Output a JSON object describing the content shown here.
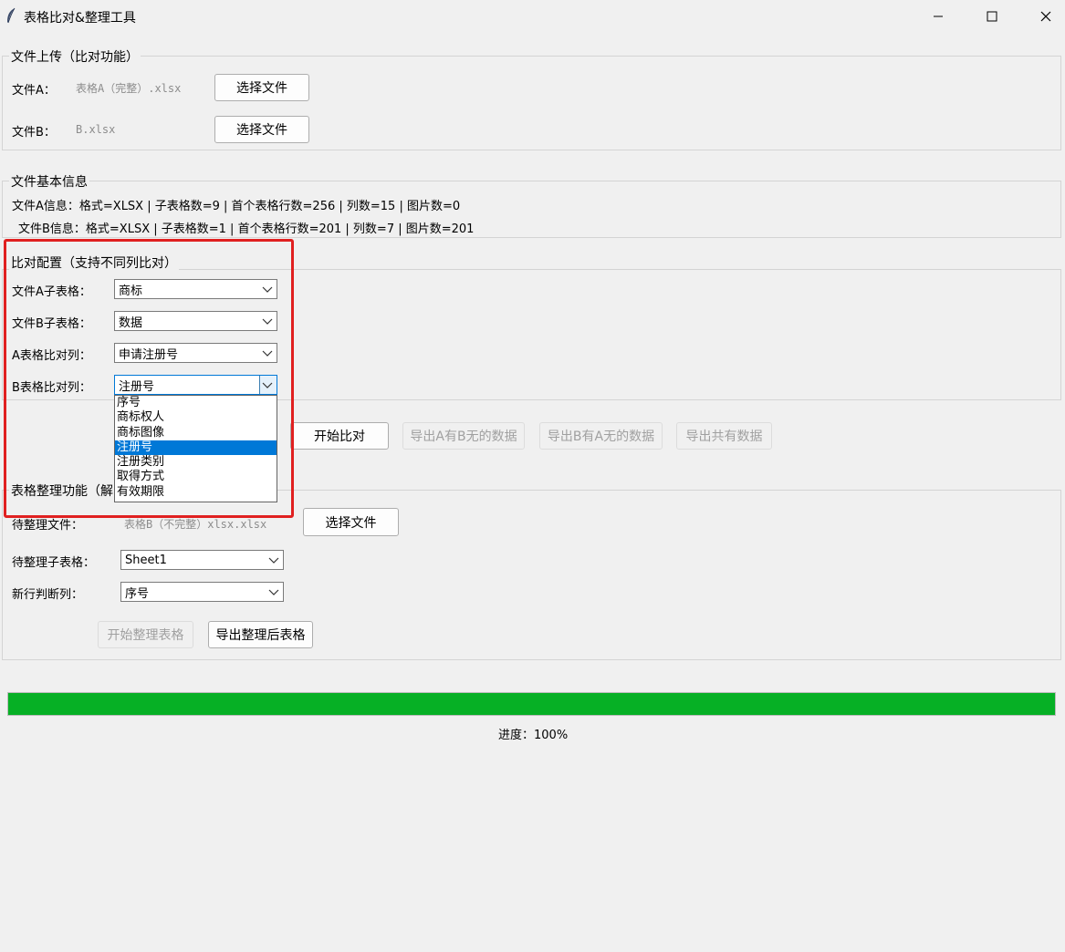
{
  "window": {
    "title": "表格比对&整理工具",
    "icon": "feather-icon"
  },
  "upload": {
    "legend": "文件上传（比对功能）",
    "fileA_label": "文件A：",
    "fileA_value": "表格A（完整）.xlsx",
    "fileB_label": "文件B：",
    "fileB_value": "B.xlsx",
    "choose_label": "选择文件"
  },
  "info": {
    "legend": "文件基本信息",
    "fileA_info": "文件A信息：格式=XLSX | 子表格数=9 | 首个表格行数=256 | 列数=15 | 图片数=0",
    "fileB_info": "文件B信息：格式=XLSX | 子表格数=1 | 首个表格行数=201 | 列数=7 | 图片数=201"
  },
  "compare": {
    "legend": "比对配置（支持不同列比对）",
    "sheetA_label": "文件A子表格：",
    "sheetA_value": "商标",
    "sheetB_label": "文件B子表格：",
    "sheetB_value": "数据",
    "colA_label": "A表格比对列：",
    "colA_value": "申请注册号",
    "colB_label": "B表格比对列：",
    "colB_value": "注册号",
    "dropdown_options": [
      "序号",
      "商标权人",
      "商标图像",
      "注册号",
      "注册类别",
      "取得方式",
      "有效期限"
    ],
    "dropdown_selected": "注册号",
    "start_label": "开始比对",
    "export_a_only": "导出A有B无的数据",
    "export_b_only": "导出B有A无的数据",
    "export_common": "导出共有数据"
  },
  "organize": {
    "legend": "表格整理功能（解",
    "file_label": "待整理文件：",
    "file_value": "表格B（不完整）xlsx.xlsx",
    "choose_label": "选择文件",
    "sheet_label": "待整理子表格：",
    "sheet_value": "Sheet1",
    "newrow_label": "新行判断列：",
    "newrow_value": "序号",
    "start_label": "开始整理表格",
    "export_label": "导出整理后表格"
  },
  "progress": {
    "percent": 100,
    "label": "进度：100%",
    "color": "#06b025"
  },
  "colors": {
    "highlight_border": "#e02020",
    "selection": "#0078d7"
  }
}
